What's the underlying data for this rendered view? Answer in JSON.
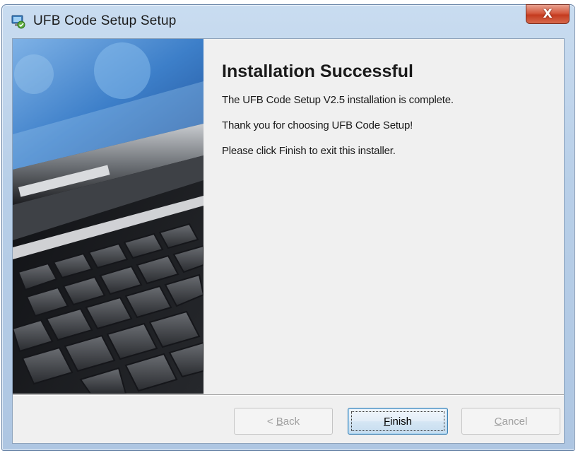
{
  "window": {
    "title": "UFB Code Setup Setup",
    "app_icon": "installer-icon",
    "close_icon": "close-icon",
    "close_glyph": "X"
  },
  "content": {
    "heading": "Installation Successful",
    "line1": "The UFB Code Setup V2.5 installation is complete.",
    "line2": "Thank you for choosing UFB Code Setup!",
    "line3": "Please click Finish to exit this installer."
  },
  "buttons": {
    "back_prefix": "< ",
    "back_mnemonic": "B",
    "back_rest": "ack",
    "back_enabled": false,
    "finish_mnemonic": "F",
    "finish_rest": "inish",
    "finish_enabled": true,
    "cancel_mnemonic": "C",
    "cancel_rest": "ancel",
    "cancel_enabled": false
  },
  "colors": {
    "titlebar": "#b8cfe8",
    "close_button": "#c43b1f",
    "client_background": "#f0f0f0",
    "primary_button_border": "#3c7fb1"
  }
}
